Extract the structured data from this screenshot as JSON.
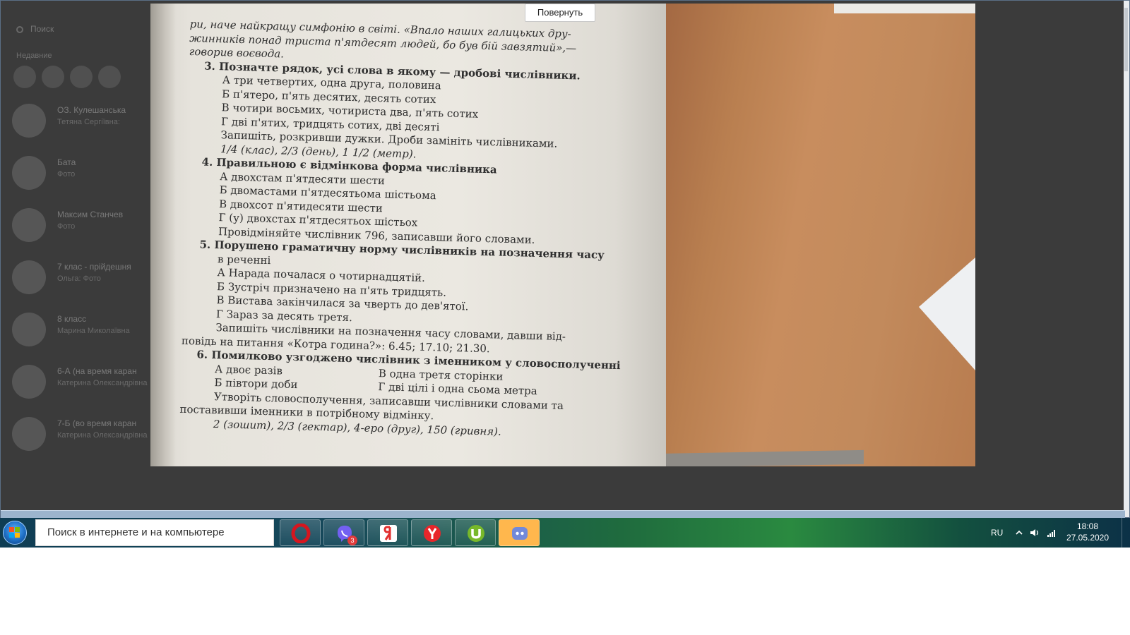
{
  "viewer": {
    "rotate_button": "Повернуть"
  },
  "sidebar": {
    "search_placeholder": "Поиск",
    "section_label": "Недавние",
    "chats": [
      {
        "name": "ОЗ. Кулешанська",
        "preview": "Тетяна Сергіївна:"
      },
      {
        "name": "Бата",
        "preview": "Фото"
      },
      {
        "name": "Максим Станчев",
        "preview": "Фото"
      },
      {
        "name": "7 клас - прійдешня",
        "preview": "Ольга: Фото"
      },
      {
        "name": "8 класс",
        "preview": "Марина Миколаївна"
      },
      {
        "name": "6-А (на время каран",
        "preview": "Катерина Олександрівна"
      },
      {
        "name": "7-Б (во время каран",
        "preview": "Катерина Олександрівна"
      }
    ]
  },
  "photo": {
    "lines": [
      {
        "text": "ри, наче найкращу симфонію в світі. «Впало наших галицьких дру-",
        "style": "it"
      },
      {
        "text": "жинників понад триста п'ятдесят людей, бо був бій завзятий»,—",
        "style": "it"
      },
      {
        "text": "говорив воєвода.",
        "style": "it"
      },
      {
        "text": "3. Позначте рядок, усі слова в якому — дробові числівники.",
        "style": "q in1"
      },
      {
        "text": "А  три четвертих, одна друга, половина",
        "style": "in2"
      },
      {
        "text": "Б  п'ятеро, п'ять десятих, десять сотих",
        "style": "in2"
      },
      {
        "text": "В  чотири восьмих, чотириста два, п'ять сотих",
        "style": "in2"
      },
      {
        "text": "Г  дві п'ятих, тридцять сотих, дві десяті",
        "style": "in2"
      },
      {
        "text": "Запишіть, розкривши дужки. Дроби замініть числівниками.",
        "style": "in2"
      },
      {
        "text": "1/4 (клас), 2/3 (день), 1 1/2 (метр).",
        "style": "it in2"
      },
      {
        "text": "4. Правильною є відмінкова форма числівника",
        "style": "q in1"
      },
      {
        "text": "А  двохстам п'ятдесяти шести",
        "style": "in2"
      },
      {
        "text": "Б  двомастами п'ятдесятьома шістьома",
        "style": "in2"
      },
      {
        "text": "В  двохсот п'ятидесяти шести",
        "style": "in2"
      },
      {
        "text": "Г  (у) двохстах п'ятдесятьох шістьох",
        "style": "in2"
      },
      {
        "text": "Провідміняйте числівник 796, записавши його словами.",
        "style": "in2"
      },
      {
        "text": "5. Порушено граматичну норму числівників на позначення часу",
        "style": "q in1"
      },
      {
        "text": "в реченні",
        "style": "in2"
      },
      {
        "text": "А  Нарада почалася о чотирнадцятій.",
        "style": "in2"
      },
      {
        "text": "Б  Зустріч призначено на п'ять тридцять.",
        "style": "in2"
      },
      {
        "text": "В  Вистава закінчилася за чверть до дев'ятої.",
        "style": "in2"
      },
      {
        "text": "Г  Зараз за десять третя.",
        "style": "in2"
      },
      {
        "text": "Запишіть числівники на позначення часу словами, давши від-",
        "style": "in2"
      },
      {
        "text": "повідь на питання «Котра година?»: 6.45; 17.10; 21.30.",
        "style": ""
      },
      {
        "text": "6. Помилково узгоджено числівник з іменником у словосполученні",
        "style": "q in1"
      }
    ],
    "q6_options": [
      {
        "left": "А  двоє разів",
        "right": "В  одна третя сторінки"
      },
      {
        "left": "Б  півтори доби",
        "right": "Г  дві цілі і одна сьома метра"
      }
    ],
    "tail_lines": [
      {
        "text": "Утворіть словосполучення, записавши числівники словами та",
        "style": "in2"
      },
      {
        "text": "поставивши іменники в потрібному відмінку.",
        "style": ""
      },
      {
        "text": "2 (зошит), 2/3 (гектар), 4-еро (друг), 150 (гривня).",
        "style": "it in2"
      }
    ]
  },
  "taskbar": {
    "search_placeholder": "Поиск в интернете и на компьютере",
    "apps": [
      {
        "name": "opera-icon",
        "color": "#d6161f"
      },
      {
        "name": "viber-icon",
        "color": "#7360f2",
        "badge": "3"
      },
      {
        "name": "yandex-browser-icon",
        "color": "#e22e2e"
      },
      {
        "name": "yandex-icon",
        "color": "#e8262a"
      },
      {
        "name": "utorrent-icon",
        "color": "#78b82a"
      },
      {
        "name": "discord-icon",
        "color": "#7289da"
      }
    ],
    "language": "RU",
    "time": "18:08",
    "date": "27.05.2020"
  }
}
